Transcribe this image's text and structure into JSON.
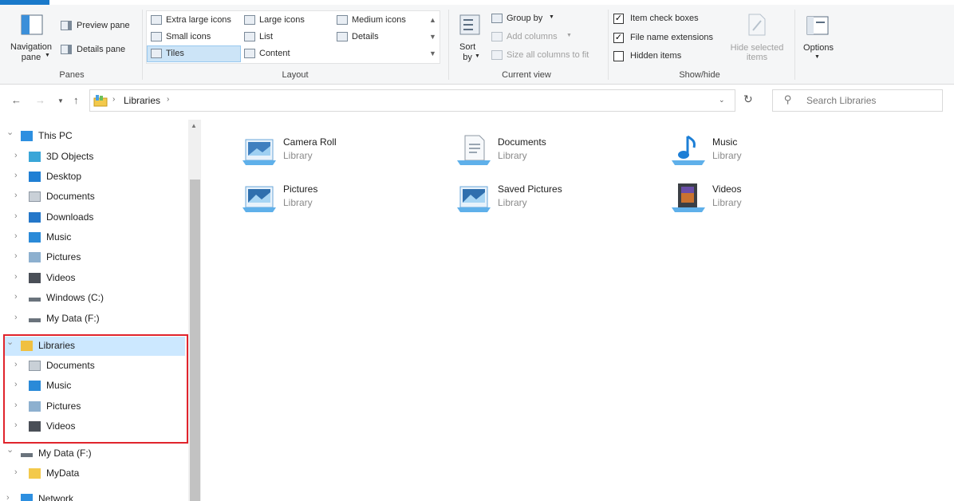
{
  "ribbon": {
    "panes": {
      "navigation_pane": "Navigation\npane",
      "preview_pane": "Preview pane",
      "details_pane": "Details pane",
      "group_label": "Panes"
    },
    "layout": {
      "extra_large_icons": "Extra large icons",
      "large_icons": "Large icons",
      "medium_icons": "Medium icons",
      "small_icons": "Small icons",
      "list": "List",
      "details": "Details",
      "tiles": "Tiles",
      "content": "Content",
      "group_label": "Layout"
    },
    "current_view": {
      "sort_by": "Sort\nby",
      "group_by": "Group by",
      "add_columns": "Add columns",
      "size_all_columns": "Size all columns to fit",
      "group_label": "Current view"
    },
    "show_hide": {
      "item_check_boxes": "Item check boxes",
      "item_check_boxes_checked": true,
      "file_name_extensions": "File name extensions",
      "file_name_extensions_checked": true,
      "hidden_items": "Hidden items",
      "hidden_items_checked": false,
      "hide_selected_items": "Hide selected\nitems",
      "group_label": "Show/hide"
    },
    "options": "Options"
  },
  "address": {
    "path": [
      "Libraries"
    ],
    "search_placeholder": "Search Libraries"
  },
  "nav_pane": {
    "items": [
      {
        "label": "This PC",
        "icon": "pc-icon",
        "expanded": true
      },
      {
        "label": "3D Objects",
        "icon": "3d-objects-icon"
      },
      {
        "label": "Desktop",
        "icon": "desktop-icon"
      },
      {
        "label": "Documents",
        "icon": "documents-icon"
      },
      {
        "label": "Downloads",
        "icon": "downloads-icon"
      },
      {
        "label": "Music",
        "icon": "music-icon"
      },
      {
        "label": "Pictures",
        "icon": "pictures-icon"
      },
      {
        "label": "Videos",
        "icon": "videos-icon"
      },
      {
        "label": "Windows (C:)",
        "icon": "drive-icon"
      },
      {
        "label": "My Data (F:)",
        "icon": "drive-icon"
      },
      {
        "label": "Libraries",
        "icon": "libraries-icon",
        "expanded": true,
        "selected": true
      },
      {
        "label": "Documents",
        "icon": "documents-icon"
      },
      {
        "label": "Music",
        "icon": "music-icon"
      },
      {
        "label": "Pictures",
        "icon": "pictures-icon"
      },
      {
        "label": "Videos",
        "icon": "videos-icon"
      },
      {
        "label": "My Data (F:)",
        "icon": "drive-icon",
        "expanded": true
      },
      {
        "label": "MyData",
        "icon": "folder-icon"
      },
      {
        "label": "Network",
        "icon": "network-icon"
      }
    ]
  },
  "content": {
    "tiles": [
      {
        "name": "Camera Roll",
        "type": "Library",
        "icon": "camera-roll-library-icon"
      },
      {
        "name": "Documents",
        "type": "Library",
        "icon": "documents-library-icon"
      },
      {
        "name": "Music",
        "type": "Library",
        "icon": "music-library-icon"
      },
      {
        "name": "Pictures",
        "type": "Library",
        "icon": "pictures-library-icon"
      },
      {
        "name": "Saved Pictures",
        "type": "Library",
        "icon": "saved-pictures-library-icon"
      },
      {
        "name": "Videos",
        "type": "Library",
        "icon": "videos-library-icon"
      }
    ]
  },
  "colors": {
    "accent": "#1979ca",
    "selection": "#cce8ff",
    "highlight_border": "#e0242c"
  }
}
